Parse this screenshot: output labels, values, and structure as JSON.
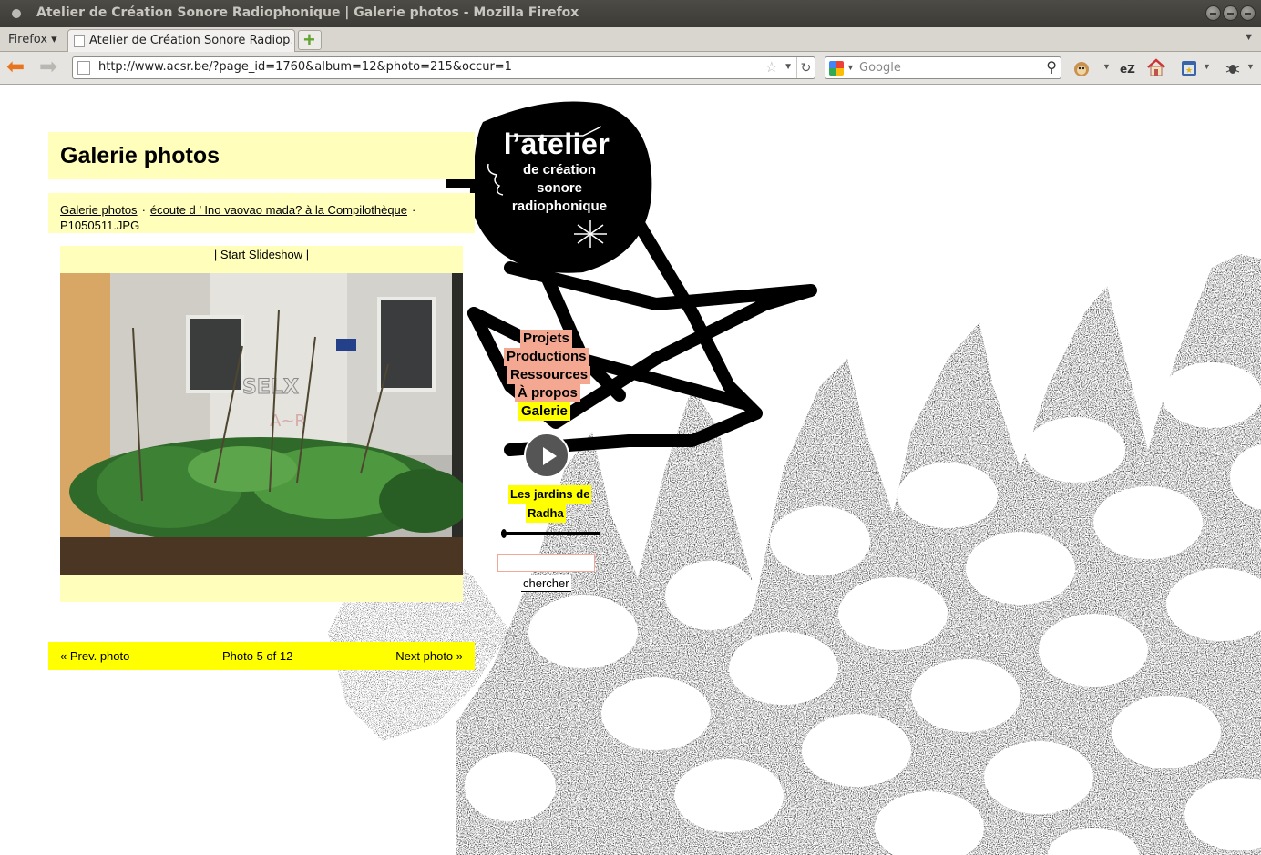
{
  "window": {
    "title": "Atelier de Création Sonore Radiophonique | Galerie photos - Mozilla Firefox"
  },
  "browser": {
    "menu_label": "Firefox",
    "tab_title": "Atelier de Création Sonore Radiop…",
    "url": "http://www.acsr.be/?page_id=1760&album=12&photo=215&occur=1",
    "search_placeholder": "Google",
    "icons": [
      "back-arrow-icon",
      "forward-arrow-icon",
      "bookmark-star-icon",
      "reload-icon",
      "google-engine-icon",
      "search-magnifier-icon",
      "greasemonkey-icon",
      "ez-icon",
      "home-icon",
      "bookmarks-icon",
      "bug-icon"
    ]
  },
  "page": {
    "title": "Galerie photos",
    "breadcrumb": {
      "gallery_link": "Galerie photos",
      "sep1": "·",
      "album_link": "écoute d ’ Ino vaovao mada? à la Compilothèque",
      "sep2": "·",
      "current": "P1050511.JPG"
    },
    "slideshow_label": "| Start Slideshow |",
    "photo_nav": {
      "prev": "« Prev. photo",
      "count": "Photo 5 of 12",
      "next": "Next photo »"
    }
  },
  "logo": {
    "line1": "l’atelier",
    "line2": "de création",
    "line3": "sonore",
    "line4": "radiophonique"
  },
  "menu": {
    "items": [
      {
        "label": "Projets"
      },
      {
        "label": "Productions"
      },
      {
        "label": "Ressources"
      },
      {
        "label": "À propos"
      },
      {
        "label": "Galerie"
      }
    ]
  },
  "player": {
    "track_line1": "Les jardins de",
    "track_line2": "Radha",
    "progress": 0.0
  },
  "search": {
    "value": "",
    "button_label": "chercher"
  },
  "colors": {
    "panel_yellow": "#ffffbb",
    "nav_yellow": "#ffff00",
    "menu_pink": "#f4a892"
  }
}
